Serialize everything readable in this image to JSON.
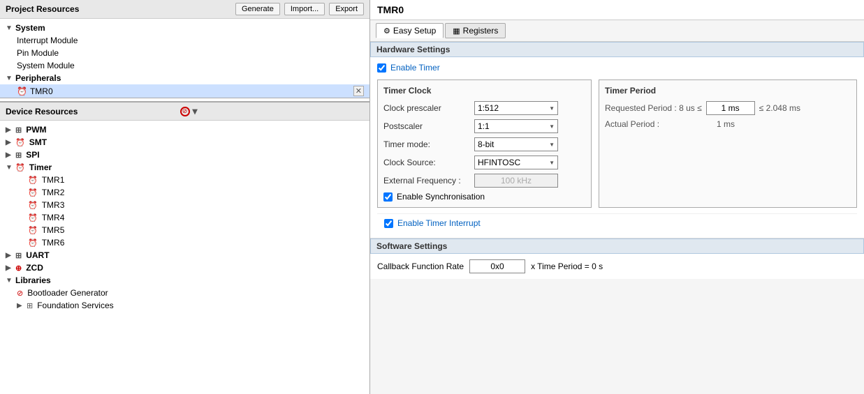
{
  "left": {
    "project_resources_label": "Project Resources",
    "generate_label": "Generate",
    "import_label": "Import...",
    "export_label": "Export",
    "system_label": "System",
    "interrupt_module_label": "Interrupt Module",
    "pin_module_label": "Pin Module",
    "system_module_label": "System Module",
    "peripherals_label": "Peripherals",
    "tmr0_label": "TMR0",
    "device_resources_label": "Device Resources",
    "pwm_label": "PWM",
    "smt_label": "SMT",
    "spi_label": "SPI",
    "timer_label": "Timer",
    "tmr1_label": "TMR1",
    "tmr2_label": "TMR2",
    "tmr3_label": "TMR3",
    "tmr4_label": "TMR4",
    "tmr5_label": "TMR5",
    "tmr6_label": "TMR6",
    "uart_label": "UART",
    "zcd_label": "ZCD",
    "libraries_label": "Libraries",
    "bootloader_label": "Bootloader Generator",
    "foundation_label": "Foundation Services"
  },
  "right": {
    "title": "TMR0",
    "tab_easy_setup": "Easy Setup",
    "tab_registers": "Registers",
    "hardware_settings_label": "Hardware Settings",
    "enable_timer_label": "Enable Timer",
    "timer_clock_title": "Timer Clock",
    "clock_prescaler_label": "Clock prescaler",
    "clock_prescaler_value": "1:512",
    "postscaler_label": "Postscaler",
    "postscaler_value": "1:1",
    "timer_mode_label": "Timer mode:",
    "timer_mode_value": "8-bit",
    "clock_source_label": "Clock Source:",
    "clock_source_value": "HFINTOSC",
    "external_freq_label": "External Frequency :",
    "external_freq_value": "100 kHz",
    "enable_sync_label": "Enable Synchronisation",
    "timer_period_title": "Timer Period",
    "requested_period_label": "Requested Period : 8 us ≤",
    "requested_period_value": "1 ms",
    "requested_period_max": "≤  2.048 ms",
    "actual_period_label": "Actual Period :",
    "actual_period_value": "1 ms",
    "enable_interrupt_label": "Enable Timer Interrupt",
    "software_settings_label": "Software Settings",
    "callback_label": "Callback Function Rate",
    "callback_value": "0x0",
    "callback_suffix": "x Time Period =  0 s"
  }
}
